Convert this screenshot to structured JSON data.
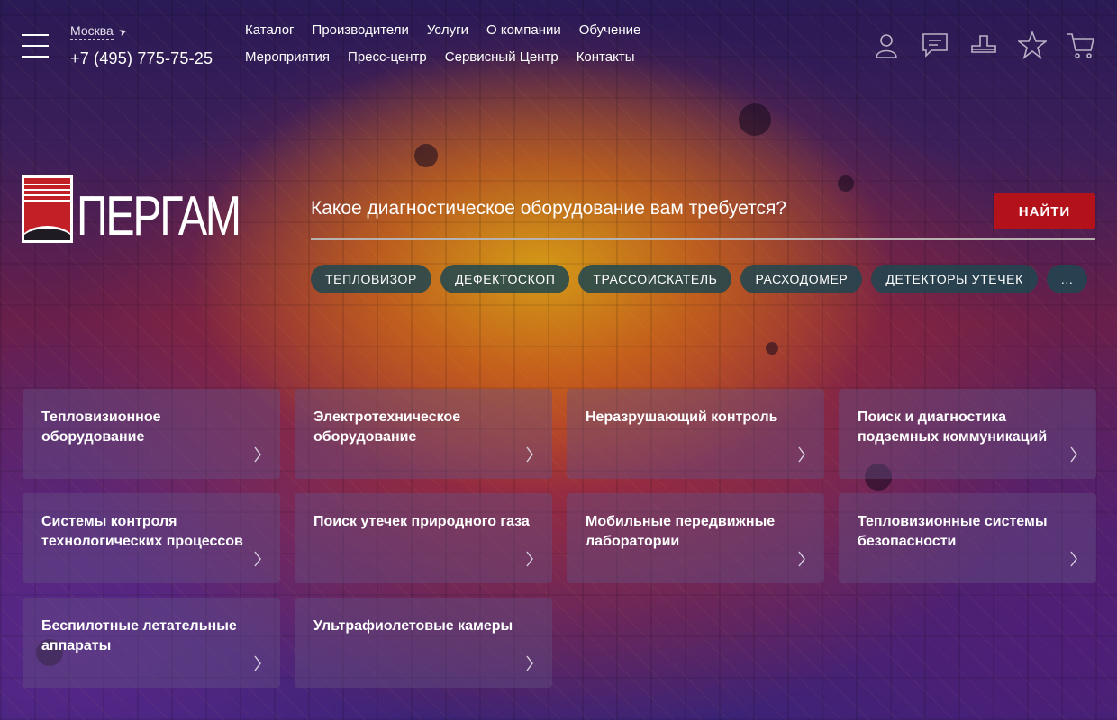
{
  "header": {
    "city": "Москва",
    "phone": "+7 (495) 775-75-25",
    "nav_row1": [
      "Каталог",
      "Производители",
      "Услуги",
      "О компании",
      "Обучение"
    ],
    "nav_row2": [
      "Мероприятия",
      "Пресс-центр",
      "Сервисный Центр",
      "Контакты"
    ],
    "icons": [
      "user-icon",
      "chat-icon",
      "compare-icon",
      "star-icon",
      "cart-icon"
    ]
  },
  "logo": {
    "text": "ПЕРГАМ"
  },
  "search": {
    "label": "Какое диагностическое оборудование вам требуется?",
    "button": "НАЙТИ"
  },
  "tags": [
    "ТЕПЛОВИЗОР",
    "ДЕФЕКТОСКОП",
    "ТРАССОИСКАТЕЛЬ",
    "РАСХОДОМЕР",
    "ДЕТЕКТОРЫ УТЕЧЕК",
    "..."
  ],
  "categories": [
    "Тепловизионное оборудование",
    "Электротехническое оборудование",
    "Неразрушающий контроль",
    "Поиск и диагностика подземных коммуникаций",
    "Системы контроля технологических процессов",
    "Поиск утечек природного газа",
    "Мобильные передвижные лаборатории",
    "Тепловизионные системы безопасности",
    "Беспилотные летательные аппараты",
    "Ультрафиолетовые камеры"
  ],
  "colors": {
    "accent_red": "#b3121a",
    "tag_bg": "#1e4650",
    "logo_red": "#c21f26"
  }
}
